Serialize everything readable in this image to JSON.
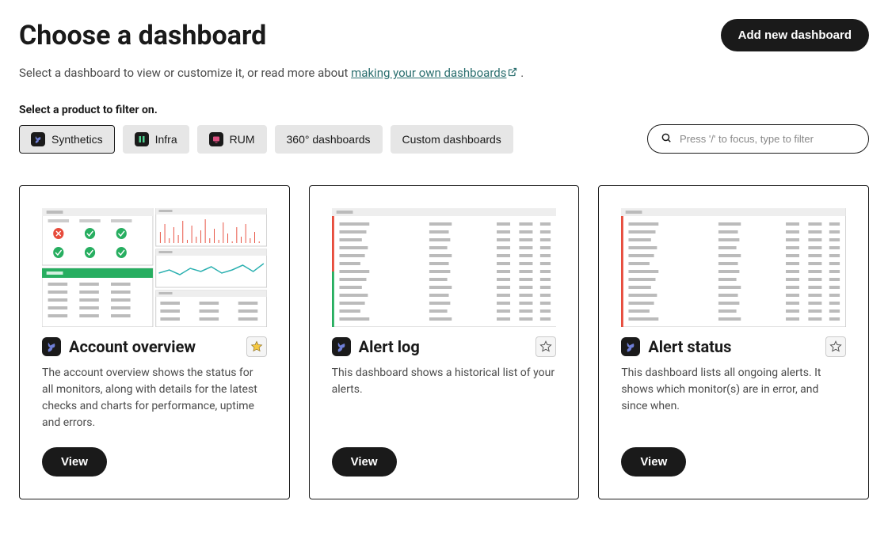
{
  "header": {
    "title": "Choose a dashboard",
    "addButton": "Add new dashboard"
  },
  "intro": {
    "prefix": "Select a dashboard to view or customize it, or read more about ",
    "link": "making your own dashboards",
    "suffix": " ."
  },
  "filter": {
    "label": "Select a product to filter on.",
    "buttons": [
      {
        "label": "Synthetics",
        "icon": "syn",
        "active": true
      },
      {
        "label": "Infra",
        "icon": "infra",
        "active": false
      },
      {
        "label": "RUM",
        "icon": "rum",
        "active": false
      },
      {
        "label": "360° dashboards",
        "icon": null,
        "active": false
      },
      {
        "label": "Custom dashboards",
        "icon": null,
        "active": false
      }
    ],
    "searchPlaceholder": "Press '/' to focus, type to filter"
  },
  "cards": [
    {
      "title": "Account overview",
      "desc": "The account overview shows the status for all monitors, along with details for the latest checks and charts for performance, uptime and errors.",
      "favored": true,
      "view": "View",
      "thumb": "overview"
    },
    {
      "title": "Alert log",
      "desc": "This dashboard shows a historical list of your alerts.",
      "favored": false,
      "view": "View",
      "thumb": "table"
    },
    {
      "title": "Alert status",
      "desc": "This dashboard lists all ongoing alerts. It shows which monitor(s) are in error, and since when.",
      "favored": false,
      "view": "View",
      "thumb": "table"
    }
  ]
}
